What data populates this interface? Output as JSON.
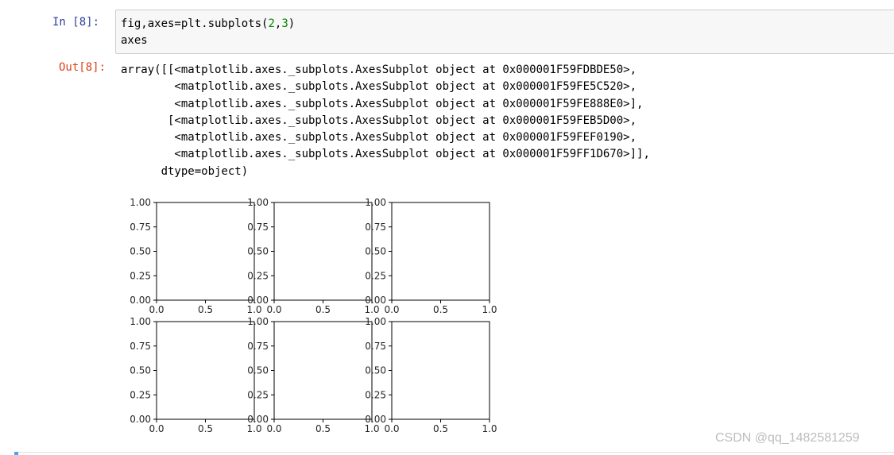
{
  "input_prompt": "In  [8]:",
  "output_prompt": "Out[8]:",
  "code": {
    "line1_var": "fig,axes=plt.subplots(",
    "line1_arg1": "2",
    "line1_comma": ",",
    "line1_arg2": "3",
    "line1_close": ")",
    "line2": "axes"
  },
  "output_lines": [
    "array([[<matplotlib.axes._subplots.AxesSubplot object at 0x000001F59FDBDE50>,",
    "        <matplotlib.axes._subplots.AxesSubplot object at 0x000001F59FE5C520>,",
    "        <matplotlib.axes._subplots.AxesSubplot object at 0x000001F59FE888E0>],",
    "       [<matplotlib.axes._subplots.AxesSubplot object at 0x000001F59FEB5D00>,",
    "        <matplotlib.axes._subplots.AxesSubplot object at 0x000001F59FEF0190>,",
    "        <matplotlib.axes._subplots.AxesSubplot object at 0x000001F59FF1D670>]],",
    "      dtype=object)"
  ],
  "chart_data": {
    "type": "line",
    "layout": "2x3 grid of empty subplots",
    "rows": 2,
    "cols": 3,
    "xlim": [
      0,
      1
    ],
    "ylim": [
      0,
      1
    ],
    "xticks": [
      "0.0",
      "0.5",
      "1.0"
    ],
    "yticks": [
      "0.00",
      "0.25",
      "0.50",
      "0.75",
      "1.00"
    ],
    "series": [],
    "grid": false
  },
  "watermark": "CSDN @qq_1482581259",
  "colors": {
    "in_prompt": "#303f9f",
    "out_prompt": "#d84315",
    "cell_bg": "#f7f7f7",
    "number": "#008800",
    "operator": "#aa22ff"
  }
}
